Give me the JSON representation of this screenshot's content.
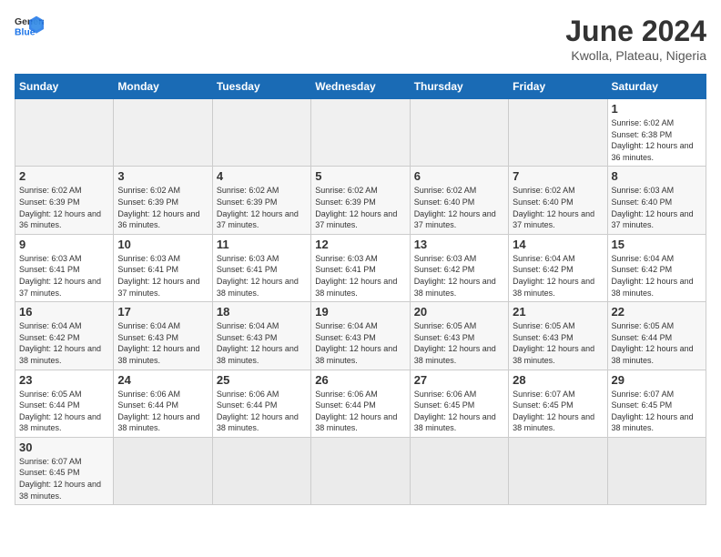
{
  "header": {
    "logo_general": "General",
    "logo_blue": "Blue",
    "title": "June 2024",
    "subtitle": "Kwolla, Plateau, Nigeria"
  },
  "days_of_week": [
    "Sunday",
    "Monday",
    "Tuesday",
    "Wednesday",
    "Thursday",
    "Friday",
    "Saturday"
  ],
  "weeks": [
    {
      "days": [
        {
          "date": "",
          "empty": true
        },
        {
          "date": "",
          "empty": true
        },
        {
          "date": "",
          "empty": true
        },
        {
          "date": "",
          "empty": true
        },
        {
          "date": "",
          "empty": true
        },
        {
          "date": "",
          "empty": true
        },
        {
          "date": "1",
          "sunrise": "Sunrise: 6:02 AM",
          "sunset": "Sunset: 6:38 PM",
          "daylight": "Daylight: 12 hours and 36 minutes."
        }
      ]
    },
    {
      "days": [
        {
          "date": "2",
          "sunrise": "Sunrise: 6:02 AM",
          "sunset": "Sunset: 6:39 PM",
          "daylight": "Daylight: 12 hours and 36 minutes."
        },
        {
          "date": "3",
          "sunrise": "Sunrise: 6:02 AM",
          "sunset": "Sunset: 6:39 PM",
          "daylight": "Daylight: 12 hours and 36 minutes."
        },
        {
          "date": "4",
          "sunrise": "Sunrise: 6:02 AM",
          "sunset": "Sunset: 6:39 PM",
          "daylight": "Daylight: 12 hours and 37 minutes."
        },
        {
          "date": "5",
          "sunrise": "Sunrise: 6:02 AM",
          "sunset": "Sunset: 6:39 PM",
          "daylight": "Daylight: 12 hours and 37 minutes."
        },
        {
          "date": "6",
          "sunrise": "Sunrise: 6:02 AM",
          "sunset": "Sunset: 6:40 PM",
          "daylight": "Daylight: 12 hours and 37 minutes."
        },
        {
          "date": "7",
          "sunrise": "Sunrise: 6:02 AM",
          "sunset": "Sunset: 6:40 PM",
          "daylight": "Daylight: 12 hours and 37 minutes."
        },
        {
          "date": "8",
          "sunrise": "Sunrise: 6:03 AM",
          "sunset": "Sunset: 6:40 PM",
          "daylight": "Daylight: 12 hours and 37 minutes."
        }
      ]
    },
    {
      "days": [
        {
          "date": "9",
          "sunrise": "Sunrise: 6:03 AM",
          "sunset": "Sunset: 6:41 PM",
          "daylight": "Daylight: 12 hours and 37 minutes."
        },
        {
          "date": "10",
          "sunrise": "Sunrise: 6:03 AM",
          "sunset": "Sunset: 6:41 PM",
          "daylight": "Daylight: 12 hours and 37 minutes."
        },
        {
          "date": "11",
          "sunrise": "Sunrise: 6:03 AM",
          "sunset": "Sunset: 6:41 PM",
          "daylight": "Daylight: 12 hours and 38 minutes."
        },
        {
          "date": "12",
          "sunrise": "Sunrise: 6:03 AM",
          "sunset": "Sunset: 6:41 PM",
          "daylight": "Daylight: 12 hours and 38 minutes."
        },
        {
          "date": "13",
          "sunrise": "Sunrise: 6:03 AM",
          "sunset": "Sunset: 6:42 PM",
          "daylight": "Daylight: 12 hours and 38 minutes."
        },
        {
          "date": "14",
          "sunrise": "Sunrise: 6:04 AM",
          "sunset": "Sunset: 6:42 PM",
          "daylight": "Daylight: 12 hours and 38 minutes."
        },
        {
          "date": "15",
          "sunrise": "Sunrise: 6:04 AM",
          "sunset": "Sunset: 6:42 PM",
          "daylight": "Daylight: 12 hours and 38 minutes."
        }
      ]
    },
    {
      "days": [
        {
          "date": "16",
          "sunrise": "Sunrise: 6:04 AM",
          "sunset": "Sunset: 6:42 PM",
          "daylight": "Daylight: 12 hours and 38 minutes."
        },
        {
          "date": "17",
          "sunrise": "Sunrise: 6:04 AM",
          "sunset": "Sunset: 6:43 PM",
          "daylight": "Daylight: 12 hours and 38 minutes."
        },
        {
          "date": "18",
          "sunrise": "Sunrise: 6:04 AM",
          "sunset": "Sunset: 6:43 PM",
          "daylight": "Daylight: 12 hours and 38 minutes."
        },
        {
          "date": "19",
          "sunrise": "Sunrise: 6:04 AM",
          "sunset": "Sunset: 6:43 PM",
          "daylight": "Daylight: 12 hours and 38 minutes."
        },
        {
          "date": "20",
          "sunrise": "Sunrise: 6:05 AM",
          "sunset": "Sunset: 6:43 PM",
          "daylight": "Daylight: 12 hours and 38 minutes."
        },
        {
          "date": "21",
          "sunrise": "Sunrise: 6:05 AM",
          "sunset": "Sunset: 6:43 PM",
          "daylight": "Daylight: 12 hours and 38 minutes."
        },
        {
          "date": "22",
          "sunrise": "Sunrise: 6:05 AM",
          "sunset": "Sunset: 6:44 PM",
          "daylight": "Daylight: 12 hours and 38 minutes."
        }
      ]
    },
    {
      "days": [
        {
          "date": "23",
          "sunrise": "Sunrise: 6:05 AM",
          "sunset": "Sunset: 6:44 PM",
          "daylight": "Daylight: 12 hours and 38 minutes."
        },
        {
          "date": "24",
          "sunrise": "Sunrise: 6:06 AM",
          "sunset": "Sunset: 6:44 PM",
          "daylight": "Daylight: 12 hours and 38 minutes."
        },
        {
          "date": "25",
          "sunrise": "Sunrise: 6:06 AM",
          "sunset": "Sunset: 6:44 PM",
          "daylight": "Daylight: 12 hours and 38 minutes."
        },
        {
          "date": "26",
          "sunrise": "Sunrise: 6:06 AM",
          "sunset": "Sunset: 6:44 PM",
          "daylight": "Daylight: 12 hours and 38 minutes."
        },
        {
          "date": "27",
          "sunrise": "Sunrise: 6:06 AM",
          "sunset": "Sunset: 6:45 PM",
          "daylight": "Daylight: 12 hours and 38 minutes."
        },
        {
          "date": "28",
          "sunrise": "Sunrise: 6:07 AM",
          "sunset": "Sunset: 6:45 PM",
          "daylight": "Daylight: 12 hours and 38 minutes."
        },
        {
          "date": "29",
          "sunrise": "Sunrise: 6:07 AM",
          "sunset": "Sunset: 6:45 PM",
          "daylight": "Daylight: 12 hours and 38 minutes."
        }
      ]
    },
    {
      "days": [
        {
          "date": "30",
          "sunrise": "Sunrise: 6:07 AM",
          "sunset": "Sunset: 6:45 PM",
          "daylight": "Daylight: 12 hours and 38 minutes."
        },
        {
          "date": "",
          "empty": true
        },
        {
          "date": "",
          "empty": true
        },
        {
          "date": "",
          "empty": true
        },
        {
          "date": "",
          "empty": true
        },
        {
          "date": "",
          "empty": true
        },
        {
          "date": "",
          "empty": true
        }
      ]
    }
  ]
}
